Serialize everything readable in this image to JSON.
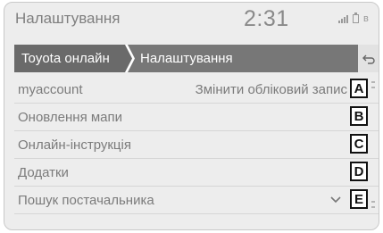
{
  "status_bar": {
    "title": "Налаштування",
    "time": "2:31",
    "icons": [
      "signal-icon",
      "battery-icon",
      "bluetooth-icon"
    ]
  },
  "breadcrumb": {
    "items": [
      "Toyota онлайн",
      "Налаштування"
    ],
    "back_icon": "back-arrow-icon"
  },
  "menu": {
    "items": [
      {
        "label": "myaccount",
        "value": "Змінити обліковий запис",
        "callout": "A"
      },
      {
        "label": "Оновлення мапи",
        "callout": "B"
      },
      {
        "label": "Онлайн-інструкція",
        "callout": "C"
      },
      {
        "label": "Додатки",
        "callout": "D"
      },
      {
        "label": "Пошук постачальника",
        "expand_icon": "chevron-down-icon",
        "callout": "E"
      }
    ]
  },
  "colors": {
    "screen_background": "#ededed",
    "breadcrumb_active": "#6a6a6a",
    "breadcrumb_current": "#777777",
    "text": "#7b7b7b"
  }
}
